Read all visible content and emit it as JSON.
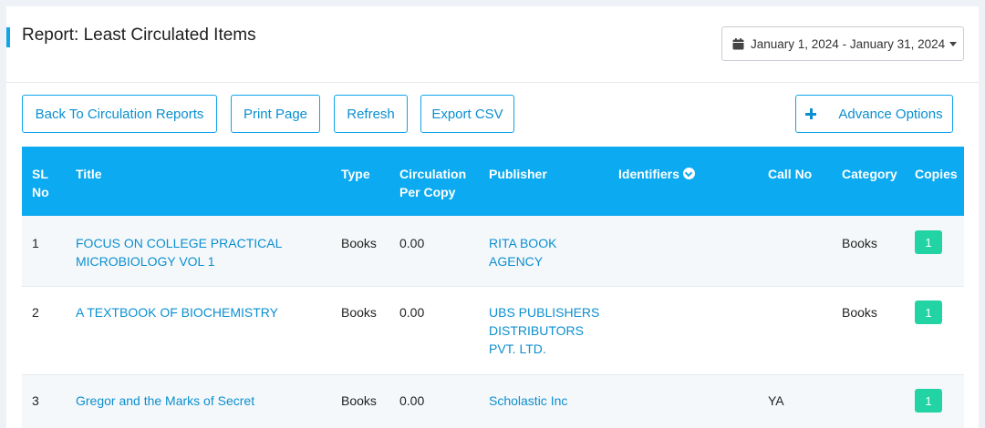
{
  "header": {
    "title": "Report: Least Circulated Items",
    "date_range": "January 1, 2024 - January 31, 2024"
  },
  "toolbar": {
    "back_label": "Back To Circulation Reports",
    "print_label": "Print Page",
    "refresh_label": "Refresh",
    "export_label": "Export CSV",
    "advance_label": "Advance Options"
  },
  "table": {
    "columns": {
      "sl_no_1": "SL",
      "sl_no_2": "No",
      "title": "Title",
      "type": "Type",
      "circulation_1": "Circulation",
      "circulation_2": "Per Copy",
      "publisher": "Publisher",
      "identifiers": "Identifiers",
      "call_no": "Call No",
      "category": "Category",
      "copies": "Copies"
    },
    "rows": [
      {
        "sl": "1",
        "title_1": "FOCUS ON COLLEGE PRACTICAL",
        "title_2": "MICROBIOLOGY VOL 1",
        "type": "Books",
        "circulation": "0.00",
        "publisher_1": "RITA BOOK",
        "publisher_2": "AGENCY",
        "publisher_3": "",
        "call_no": "",
        "category": "Books",
        "copies": "1"
      },
      {
        "sl": "2",
        "title_1": "A TEXTBOOK OF BIOCHEMISTRY",
        "title_2": "",
        "type": "Books",
        "circulation": "0.00",
        "publisher_1": "UBS PUBLISHERS",
        "publisher_2": "DISTRIBUTORS",
        "publisher_3": "PVT. LTD.",
        "call_no": "",
        "category": "Books",
        "copies": "1"
      },
      {
        "sl": "3",
        "title_1": "Gregor and the Marks of Secret",
        "title_2": "",
        "type": "Books",
        "circulation": "0.00",
        "publisher_1": "Scholastic Inc",
        "publisher_2": "",
        "publisher_3": "",
        "call_no": "YA",
        "category": "",
        "copies": "1"
      }
    ]
  },
  "colors": {
    "accent": "#0caaf0",
    "link": "#0b8fd0",
    "badge": "#22d3a4"
  }
}
